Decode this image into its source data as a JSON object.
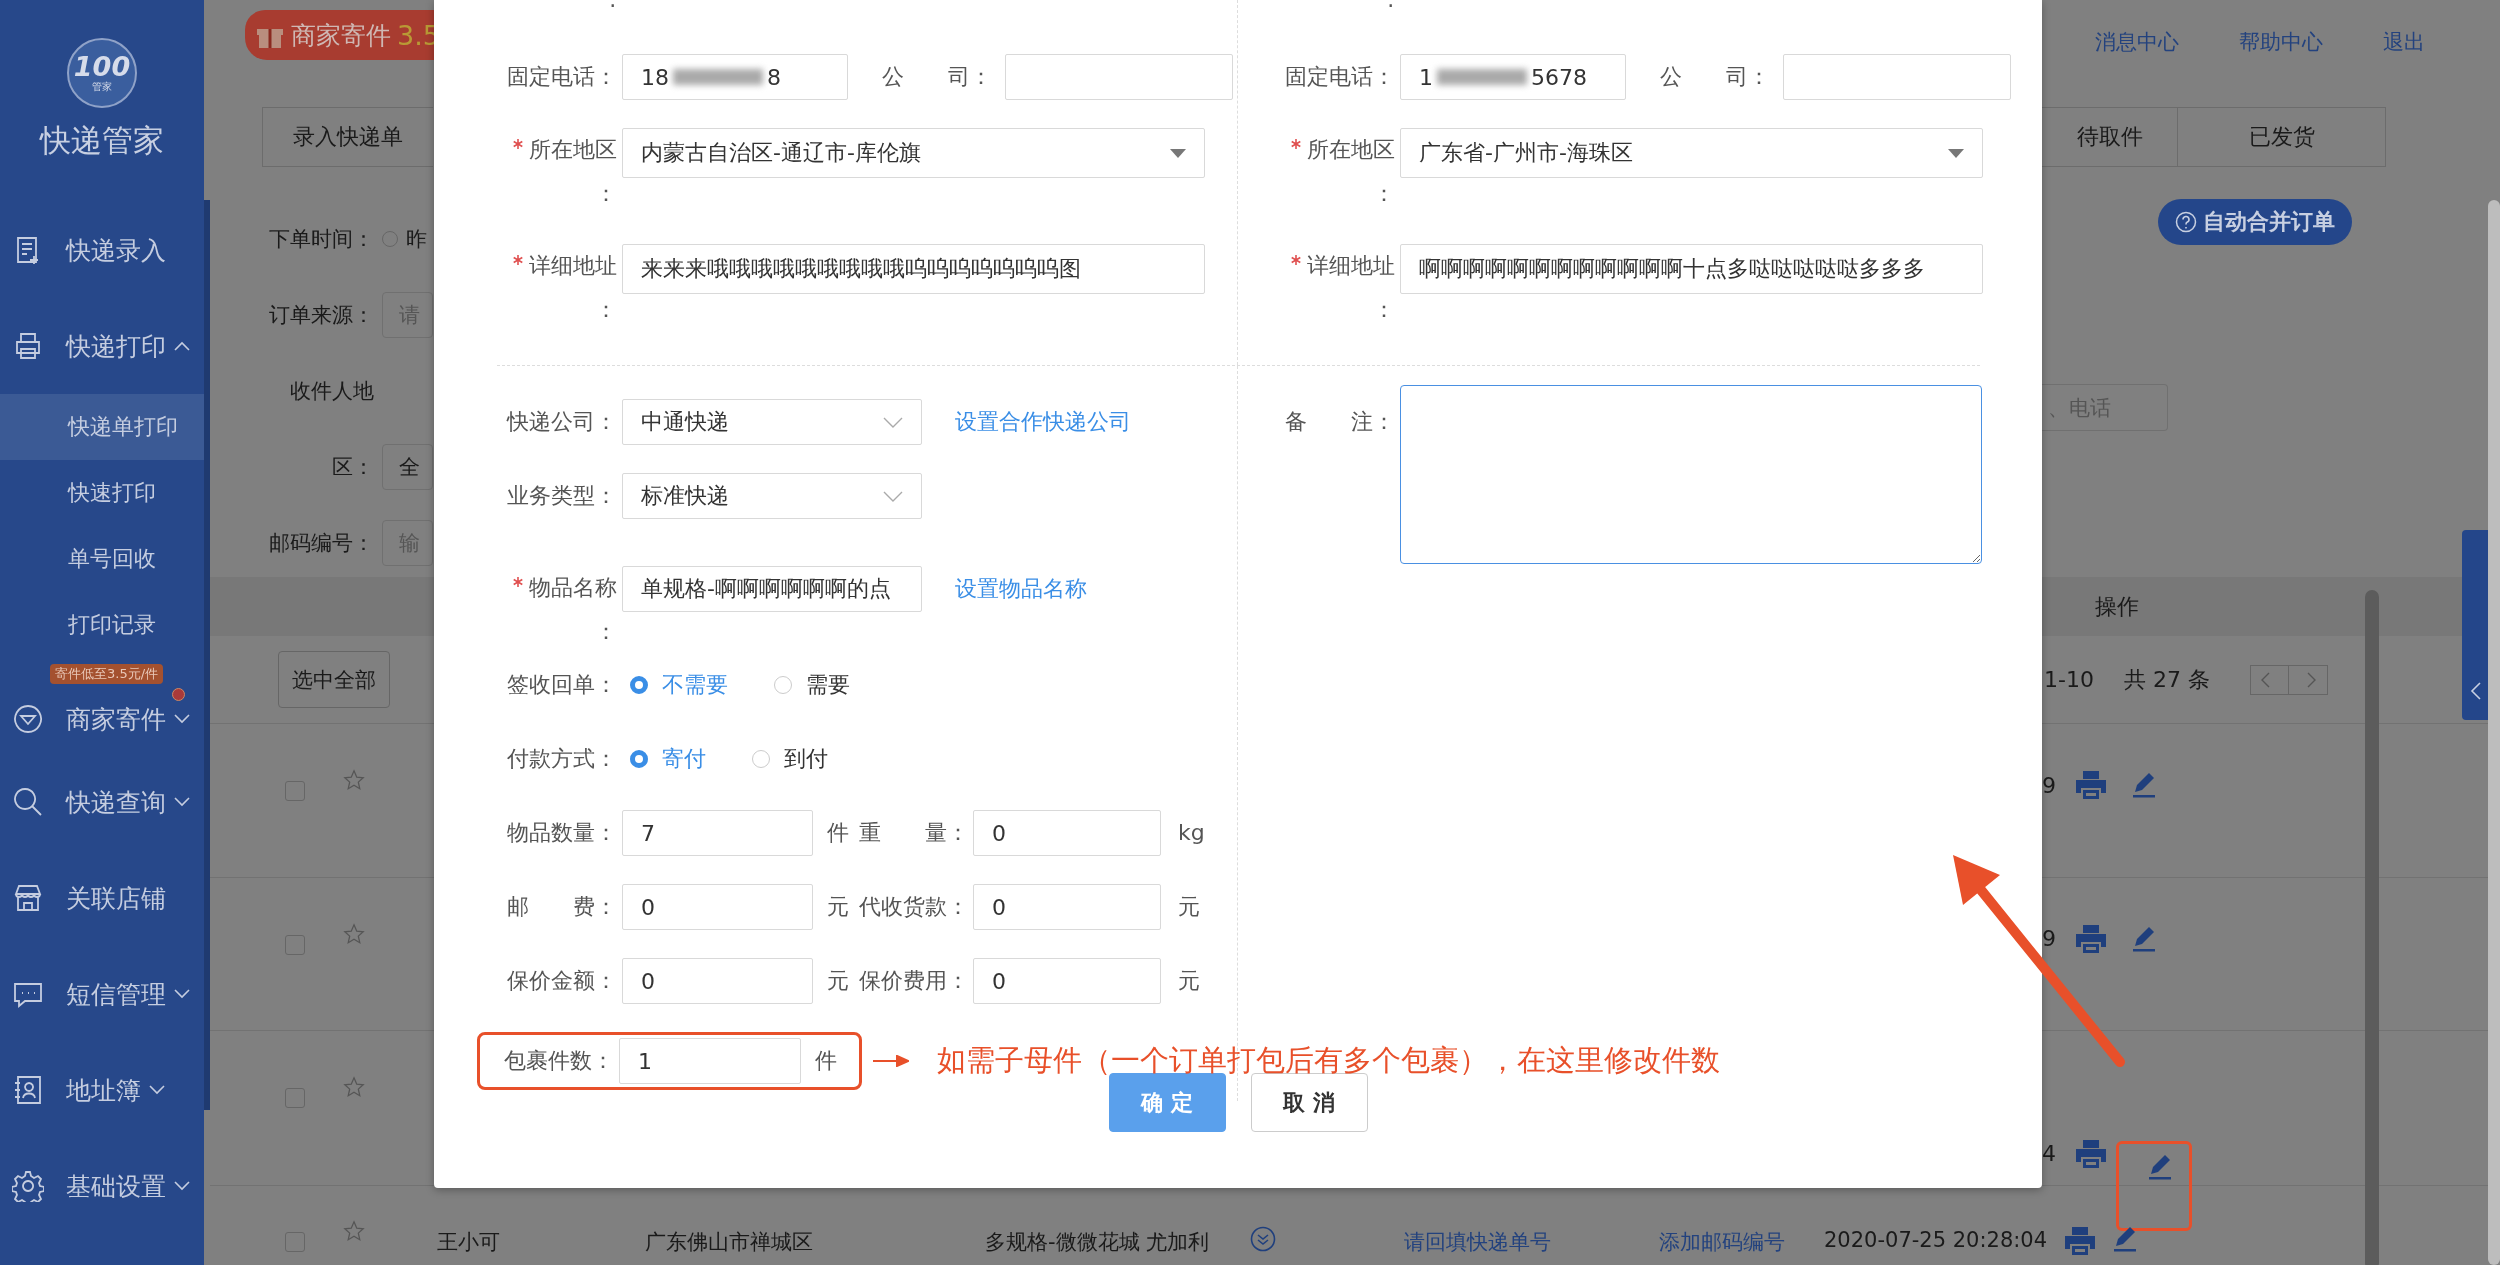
{
  "sidebar": {
    "logo": "100",
    "logo_sub": "管家",
    "title": "快递管家",
    "items": [
      {
        "label": "快递录入"
      },
      {
        "label": "快递打印",
        "expanded": true,
        "children": [
          {
            "label": "快递单打印",
            "selected": true
          },
          {
            "label": "快速打印",
            "selected": false
          },
          {
            "label": "单号回收",
            "selected": false
          },
          {
            "label": "打印记录",
            "selected": false
          }
        ]
      },
      {
        "label": "商家寄件",
        "expanded": false,
        "badge": "寄件低至3.5元/件",
        "unread": true
      },
      {
        "label": "快递查询",
        "expanded": false
      },
      {
        "label": "关联店铺"
      },
      {
        "label": "短信管理",
        "expanded": false
      },
      {
        "label": "地址簿",
        "expanded": false
      },
      {
        "label": "基础设置",
        "expanded": false
      }
    ]
  },
  "banner": {
    "label": "商家寄件",
    "price": "3.5"
  },
  "top_links": [
    "消息中心",
    "帮助中心",
    "退出"
  ],
  "tabs": [
    {
      "label": "录入快递单"
    },
    {
      "label": "待取件"
    },
    {
      "label": "已发货"
    }
  ],
  "filters": [
    {
      "kind": "radio",
      "label": "下单时间：",
      "value": "昨",
      "selected": false
    },
    {
      "kind": "input",
      "label": "订单来源：",
      "placeholder": "请"
    },
    {
      "kind": "text",
      "label": "收件人地"
    },
    {
      "kind": "input",
      "label": "区：",
      "value": "全"
    },
    {
      "kind": "input",
      "label": "邮码编号：",
      "placeholder": "输"
    }
  ],
  "merge_button": "自动合并订单",
  "search": {
    "placeholder": "、电话"
  },
  "table": {
    "ops_header": "操作",
    "select_all": "选中全部",
    "range": "1-10",
    "total": "共 27 条",
    "rows": [
      {
        "checked": false,
        "starred": false,
        "time": "9"
      },
      {
        "checked": false,
        "starred": false,
        "time": "9"
      },
      {
        "checked": false,
        "starred": false,
        "time": "4",
        "highlighted": true
      },
      {
        "checked": false,
        "starred": false,
        "name": "王小可",
        "region": "广东佛山市禅城区",
        "item": "多规格-微微花城 尤加利",
        "tracking": "请回填快递单号",
        "postcode": "添加邮码编号",
        "time": "2020-07-25 20:28:04"
      }
    ]
  },
  "dialog": {
    "sender": {
      "top_colon": ":",
      "phone": {
        "label": "固定电话：",
        "prefix": "18",
        "suffix": "8"
      },
      "company": {
        "label": "公　　司："
      },
      "region": {
        "label": "所在地区：",
        "required": true,
        "value": "内蒙古自治区-通辽市-库伦旗"
      },
      "address": {
        "label": "详细地址：",
        "required": true,
        "value": "来来来哦哦哦哦哦哦哦哦哦呜呜呜呜呜呜呜图"
      }
    },
    "receiver": {
      "top_colon": ":",
      "phone": {
        "label": "固定电话：",
        "prefix": "1",
        "suffix": "5678"
      },
      "company": {
        "label": "公　　司："
      },
      "region": {
        "label": "所在地区：",
        "required": true,
        "value": "广东省-广州市-海珠区"
      },
      "address": {
        "label": "详细地址：",
        "required": true,
        "value": "啊啊啊啊啊啊啊啊啊啊啊啊十点多哒哒哒哒哒多多多"
      }
    },
    "fields": [
      {
        "kind": "select",
        "label": "快递公司：",
        "value": "中通快递",
        "link": "设置合作快递公司"
      },
      {
        "kind": "select",
        "label": "业务类型：",
        "value": "标准快递"
      },
      {
        "kind": "input",
        "label": "物品名称：",
        "required": true,
        "value": "单规格-啊啊啊啊啊啊的点",
        "link": "设置物品名称"
      },
      {
        "kind": "radio",
        "label": "签收回单：",
        "options": [
          {
            "label": "不需要",
            "selected": true
          },
          {
            "label": "需要",
            "selected": false
          }
        ]
      },
      {
        "kind": "radio",
        "label": "付款方式：",
        "options": [
          {
            "label": "寄付",
            "selected": true
          },
          {
            "label": "到付",
            "selected": false
          }
        ]
      },
      {
        "kind": "pair",
        "label": "物品数量：",
        "value": "7",
        "unit": "件",
        "label2": "重　　量：",
        "value2": "0",
        "unit2": "kg"
      },
      {
        "kind": "pair",
        "label": "邮　　费：",
        "value": "0",
        "unit": "元",
        "label2": "代收货款：",
        "value2": "0",
        "unit2": "元"
      },
      {
        "kind": "pair",
        "label": "保价金额：",
        "value": "0",
        "unit": "元",
        "label2": "保价费用：",
        "value2": "0",
        "unit2": "元"
      },
      {
        "kind": "count",
        "label": "包裹件数：",
        "value": "1",
        "unit": "件",
        "highlighted": true
      }
    ],
    "note": {
      "label": "备　　注：",
      "focused": true
    },
    "buttons": [
      {
        "label": "确 定",
        "kind": "primary"
      },
      {
        "label": "取 消",
        "kind": "default"
      }
    ]
  },
  "annotation": {
    "text": "如需子母件（一个订单打包后有多个包裹），在这里修改件数"
  }
}
